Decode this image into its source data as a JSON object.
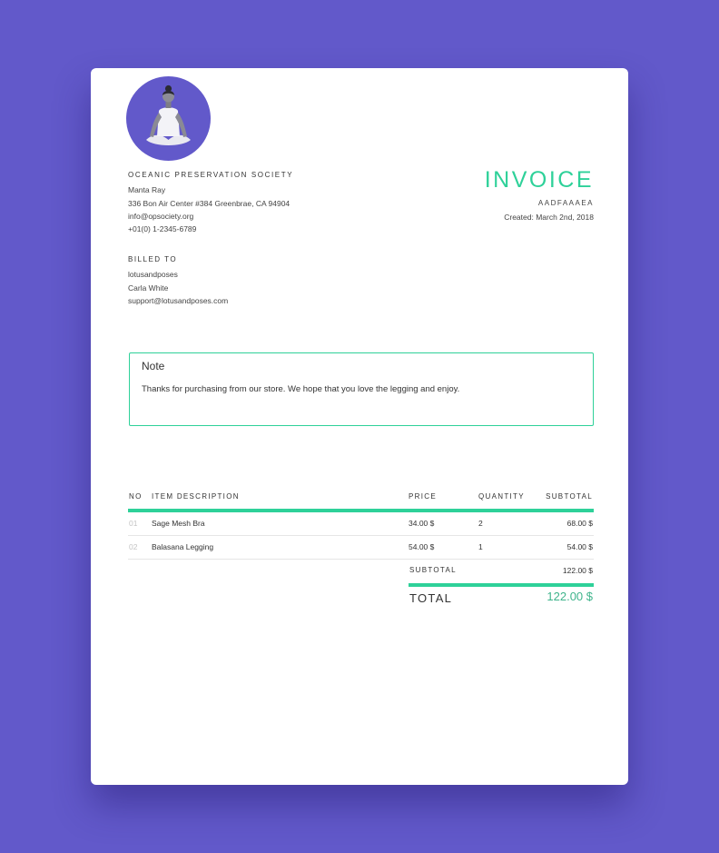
{
  "company": {
    "name": "OCEANIC PRESERVATION SOCIETY",
    "contact": "Manta Ray",
    "address": "336 Bon Air Center #384 Greenbrae, CA 94904",
    "email": "info@opsociety.org",
    "phone": "+01(0) 1-2345-6789"
  },
  "billed_to": {
    "label": "BILLED TO",
    "company": "lotusandposes",
    "name": "Carla White",
    "email": "support@lotusandposes.com"
  },
  "invoice": {
    "title": "INVOICE",
    "number": "AADFAAAEA",
    "created": "Created: March 2nd, 2018"
  },
  "note": {
    "title": "Note",
    "body": "Thanks for purchasing from our store. We hope that you love the legging and enjoy."
  },
  "table": {
    "headers": {
      "no": "NO",
      "description": "ITEM DESCRIPTION",
      "price": "PRICE",
      "quantity": "QUANTITY",
      "subtotal": "SUBTOTAL"
    },
    "items": [
      {
        "no": "01",
        "description": "Sage Mesh Bra",
        "price": "34.00 $",
        "quantity": "2",
        "subtotal": "68.00 $"
      },
      {
        "no": "02",
        "description": "Balasana Legging",
        "price": "54.00 $",
        "quantity": "1",
        "subtotal": "54.00 $"
      }
    ],
    "subtotal_label": "SUBTOTAL",
    "subtotal_value": "122.00 $",
    "total_label": "TOTAL",
    "total_value": "122.00 $"
  },
  "colors": {
    "background": "#6259ca",
    "accent": "#2ed199",
    "total_value": "#3fb48c"
  },
  "icons": {
    "logo": "meditating-person-icon"
  }
}
